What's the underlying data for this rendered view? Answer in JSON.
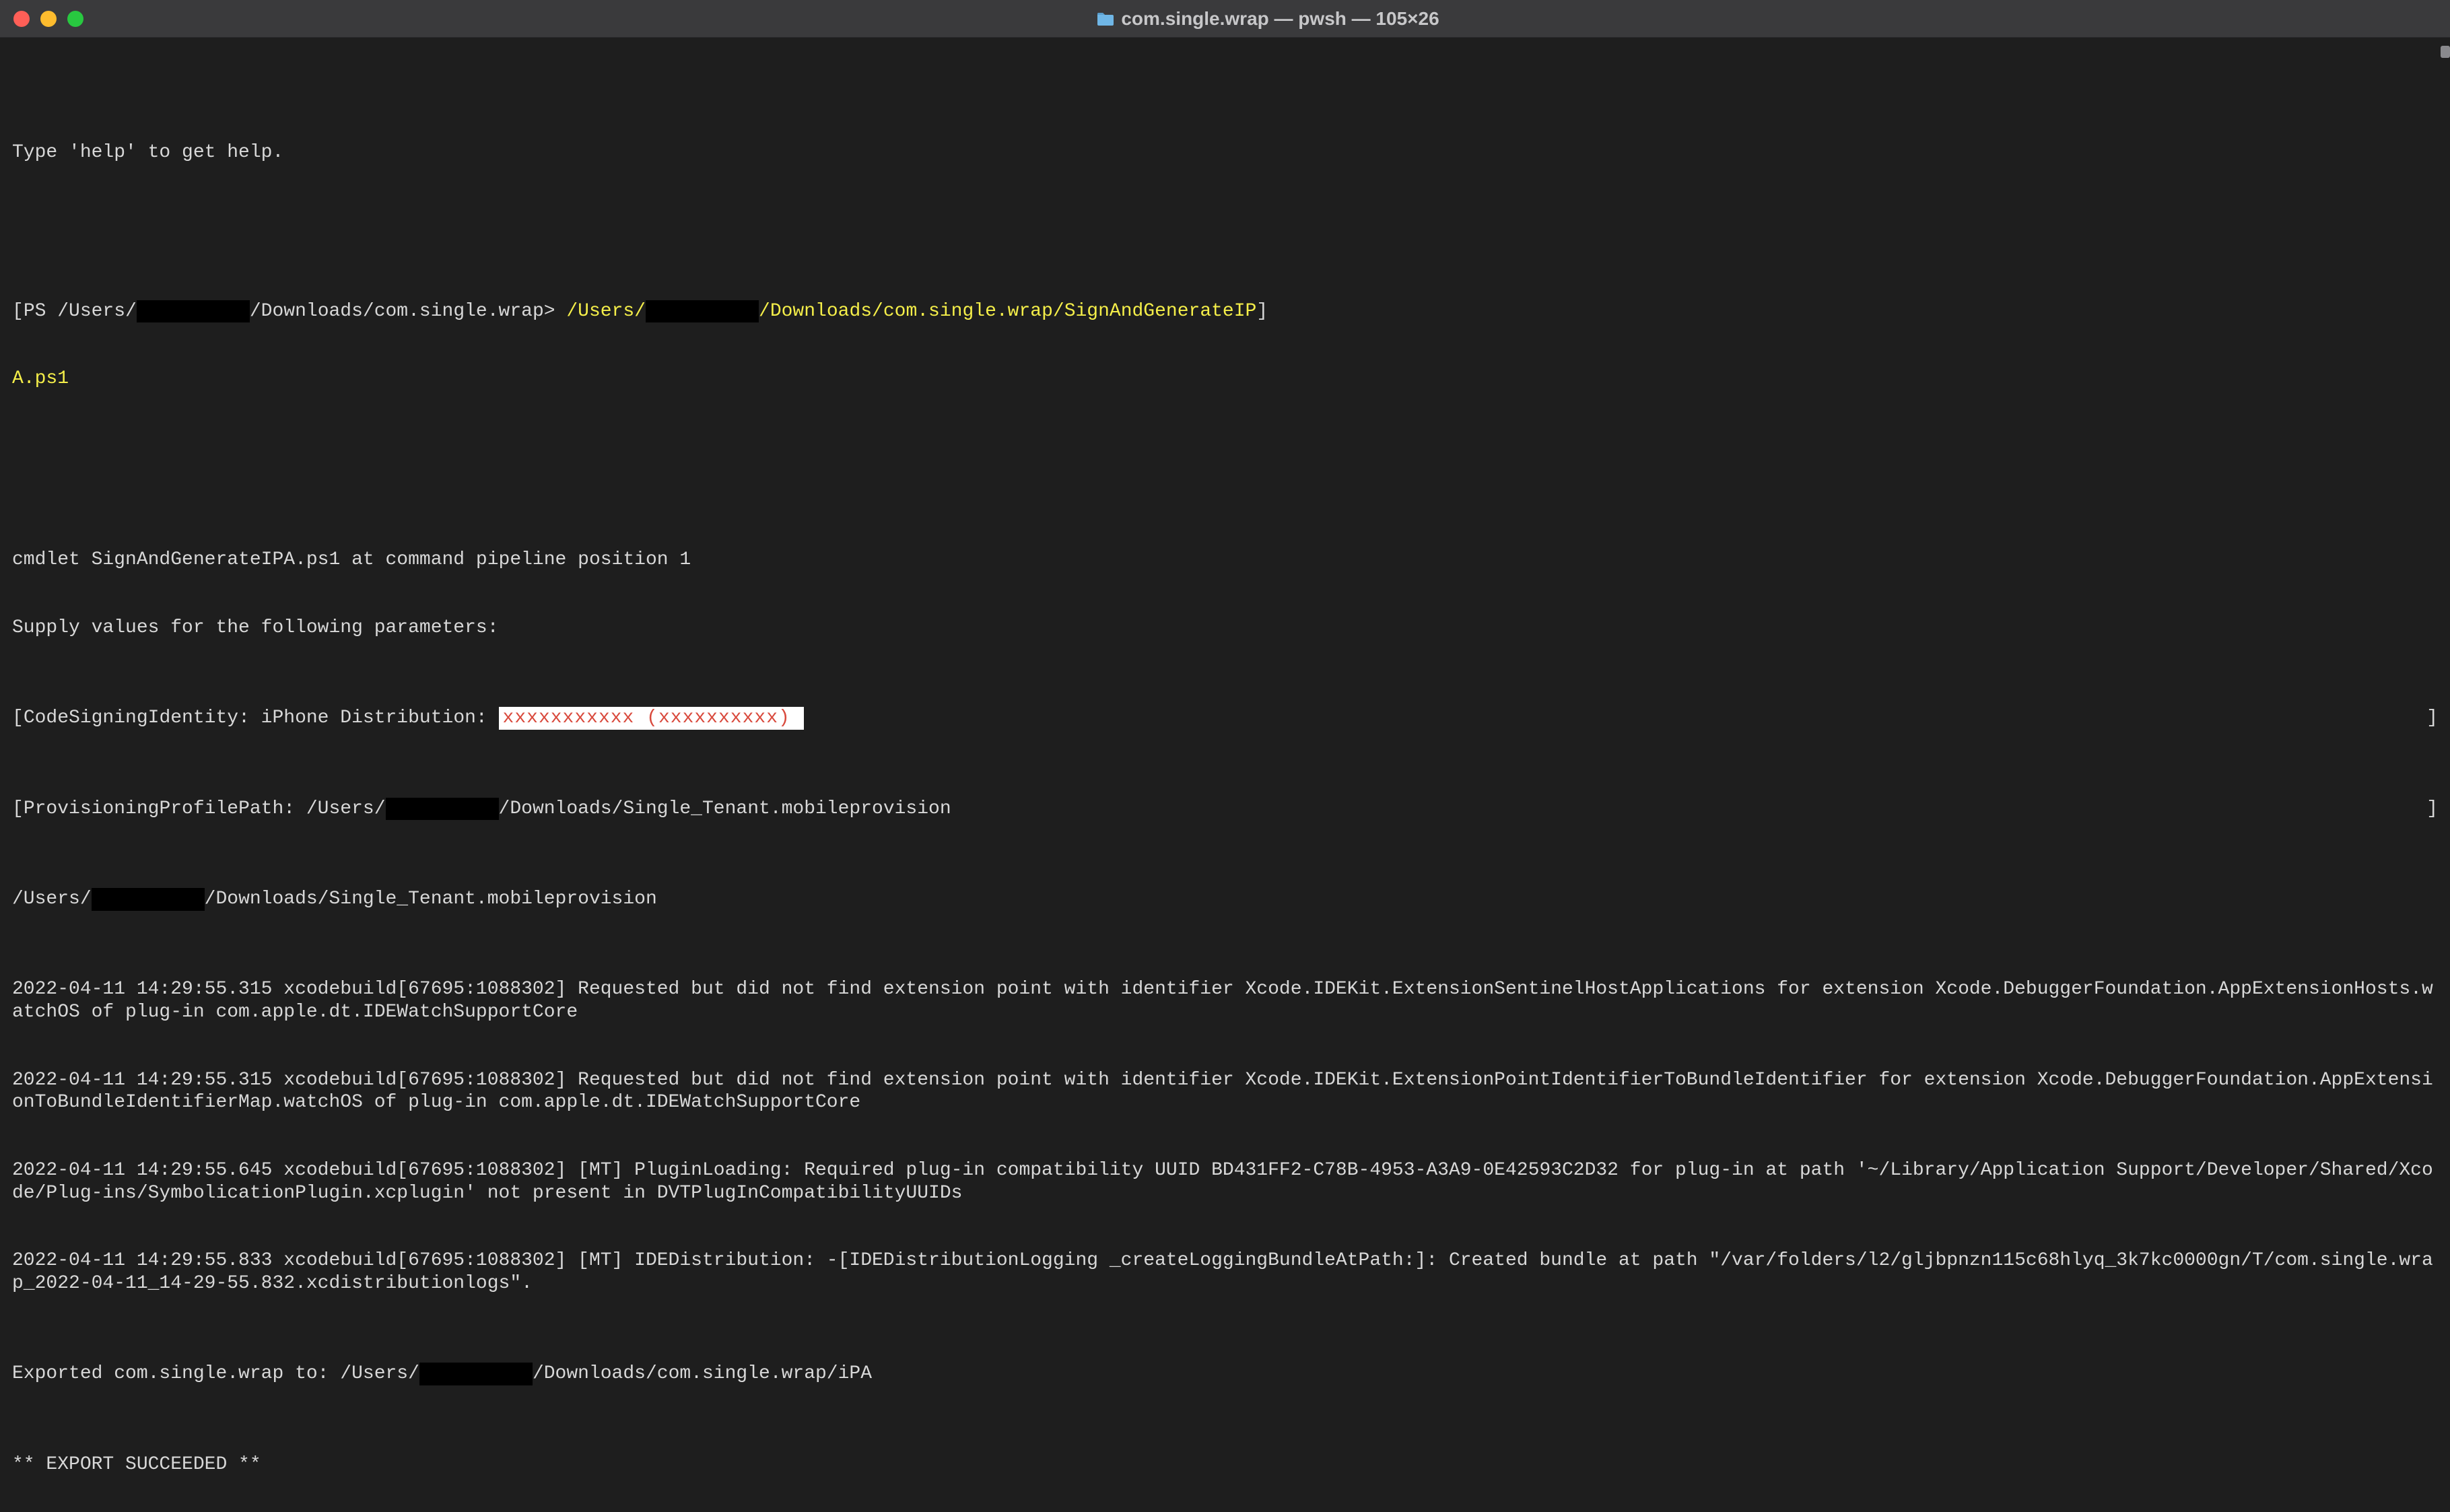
{
  "window": {
    "title": "com.single.wrap — pwsh — 105×26"
  },
  "terminal": {
    "help_line": "Type 'help' to get help.",
    "prompt_open": "[",
    "prompt_prefix": "PS /Users/",
    "redacted_user1": "          ",
    "prompt_suffix": "/Downloads/com.single.wrap> ",
    "command_part1": "/Users/",
    "redacted_user2": "          ",
    "command_part2": "/Downloads/com.single.wrap/SignAndGenerateIP",
    "prompt_close": "]",
    "command_wrap": "A.ps1",
    "cmdlet_line": "cmdlet SignAndGenerateIPA.ps1 at command pipeline position 1",
    "supply_line": "Supply values for the following parameters:",
    "csi_open": "[",
    "csi_label": "CodeSigningIdentity: iPhone Distribution: ",
    "csi_redacted": "xxxxxxxxxxx (xxxxxxxxxx)",
    "csi_close": "]",
    "ppp_open": "[",
    "ppp_label": "ProvisioningProfilePath: /Users/",
    "redacted_user3": "          ",
    "ppp_tail": "/Downloads/Single_Tenant.mobileprovision",
    "ppp_close": "]",
    "echo_path_a": "/Users/",
    "redacted_user4": "          ",
    "echo_path_b": "/Downloads/Single_Tenant.mobileprovision",
    "log1": "2022-04-11 14:29:55.315 xcodebuild[67695:1088302] Requested but did not find extension point with identifier Xcode.IDEKit.ExtensionSentinelHostApplications for extension Xcode.DebuggerFoundation.AppExtensionHosts.watchOS of plug-in com.apple.dt.IDEWatchSupportCore",
    "log2": "2022-04-11 14:29:55.315 xcodebuild[67695:1088302] Requested but did not find extension point with identifier Xcode.IDEKit.ExtensionPointIdentifierToBundleIdentifier for extension Xcode.DebuggerFoundation.AppExtensionToBundleIdentifierMap.watchOS of plug-in com.apple.dt.IDEWatchSupportCore",
    "log3": "2022-04-11 14:29:55.645 xcodebuild[67695:1088302] [MT] PluginLoading: Required plug-in compatibility UUID BD431FF2-C78B-4953-A3A9-0E42593C2D32 for plug-in at path '~/Library/Application Support/Developer/Shared/Xcode/Plug-ins/SymbolicationPlugin.xcplugin' not present in DVTPlugInCompatibilityUUIDs",
    "log4": "2022-04-11 14:29:55.833 xcodebuild[67695:1088302] [MT] IDEDistribution: -[IDEDistributionLogging _createLoggingBundleAtPath:]: Created bundle at path \"/var/folders/l2/gljbpnzn115c68hlyq_3k7kc0000gn/T/com.single.wrap_2022-04-11_14-29-55.832.xcdistributionlogs\".",
    "exported_a": "Exported com.single.wrap to: /Users/",
    "redacted_user5": "          ",
    "exported_b": "/Downloads/com.single.wrap/iPA",
    "succeeded": "** EXPORT SUCCEEDED **"
  }
}
